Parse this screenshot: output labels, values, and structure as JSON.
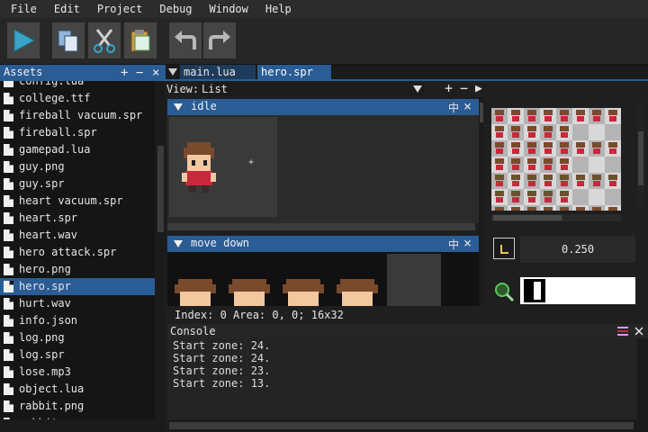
{
  "menu": [
    "File",
    "Edit",
    "Project",
    "Debug",
    "Window",
    "Help"
  ],
  "toolbar": {
    "buttons": [
      {
        "name": "run-button",
        "icon": "play-icon"
      },
      {
        "name": "copy-button",
        "icon": "copy-icon"
      },
      {
        "name": "cut-button",
        "icon": "scissors-icon"
      },
      {
        "name": "paste-button",
        "icon": "clipboard-icon"
      },
      {
        "name": "undo-button",
        "icon": "undo-icon"
      },
      {
        "name": "redo-button",
        "icon": "redo-icon"
      }
    ]
  },
  "assets": {
    "title": "Assets",
    "add": "+",
    "remove": "−",
    "close": "×",
    "items": [
      "config.lua",
      "college.ttf",
      "fireball vacuum.spr",
      "fireball.spr",
      "gamepad.lua",
      "guy.png",
      "guy.spr",
      "heart vacuum.spr",
      "heart.spr",
      "heart.wav",
      "hero attack.spr",
      "hero.png",
      "hero.spr",
      "hurt.wav",
      "info.json",
      "log.png",
      "log.spr",
      "lose.mp3",
      "object.lua",
      "rabbit.png",
      "rabbit.spr"
    ],
    "selected": "hero.spr"
  },
  "tabs": [
    {
      "label": "main.lua",
      "active": false
    },
    {
      "label": "hero.spr",
      "active": true
    }
  ],
  "view": {
    "label": "View:",
    "value": "List",
    "add": "+",
    "remove": "−",
    "play": "▶"
  },
  "animations": [
    {
      "name": "idle",
      "pin": "中",
      "close": "×"
    },
    {
      "name": "move down",
      "pin": "中",
      "close": "×"
    }
  ],
  "frame": {
    "interval": "0.250"
  },
  "status": "Index: 0   Area: 0, 0; 16x32",
  "console": {
    "title": "Console",
    "lines": [
      "Start zone: 24.",
      "Start zone: 24.",
      "Start zone: 23.",
      "Start zone: 13."
    ]
  },
  "colors": {
    "accent": "#2a5c95",
    "background": "#1e1e1e",
    "sprite_shirt": "#c8283c",
    "sprite_hair": "#7a4a2c"
  }
}
